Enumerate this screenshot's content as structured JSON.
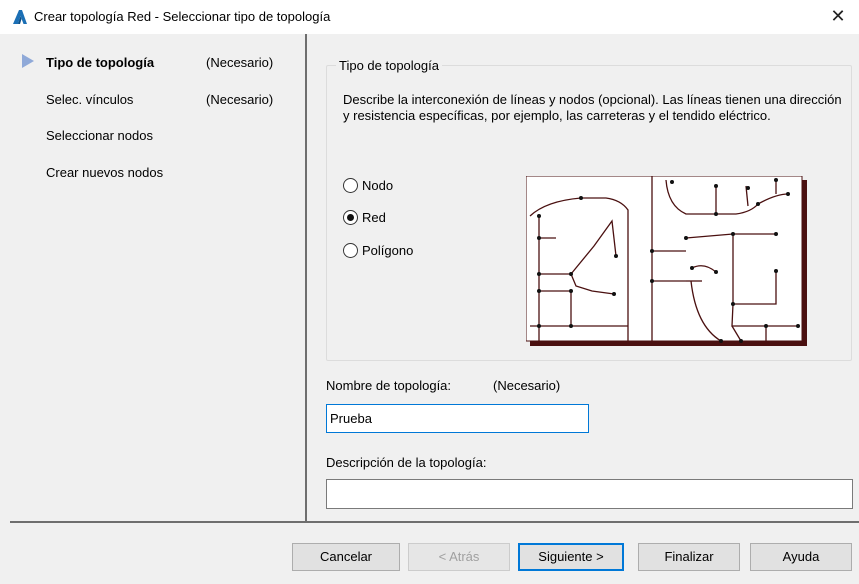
{
  "window": {
    "title": "Crear topología Red - Seleccionar tipo de topología",
    "close_glyph": "✕",
    "app_icon": "autocad-a-icon"
  },
  "steps": [
    {
      "label": "Tipo de topología",
      "required": "(Necesario)",
      "active": true
    },
    {
      "label": "Selec. vínculos",
      "required": "(Necesario)",
      "active": false
    },
    {
      "label": "Seleccionar nodos",
      "required": "",
      "active": false
    },
    {
      "label": "Crear nuevos nodos",
      "required": "",
      "active": false
    }
  ],
  "topology_type": {
    "group_label": "Tipo de topología",
    "description": "Describe la interconexión de líneas y nodos (opcional). Las líneas tienen una dirección y resistencia específicas, por ejemplo, las carreteras y el tendido eléctrico.",
    "options": [
      {
        "label": "Nodo",
        "checked": false
      },
      {
        "label": "Red",
        "checked": true
      },
      {
        "label": "Polígono",
        "checked": false
      }
    ]
  },
  "name_field": {
    "label": "Nombre de topología:",
    "required": "(Necesario)",
    "value": "Prueba"
  },
  "description_field": {
    "label": "Descripción de la topología:",
    "value": ""
  },
  "buttons": {
    "cancel": "Cancelar",
    "back": "< Atrás",
    "next": "Siguiente >",
    "finish": "Finalizar",
    "help": "Ayuda"
  },
  "colors": {
    "accent": "#0078d7",
    "step_arrow": "#8fa9d8",
    "preview_lines": "#4a1010"
  }
}
